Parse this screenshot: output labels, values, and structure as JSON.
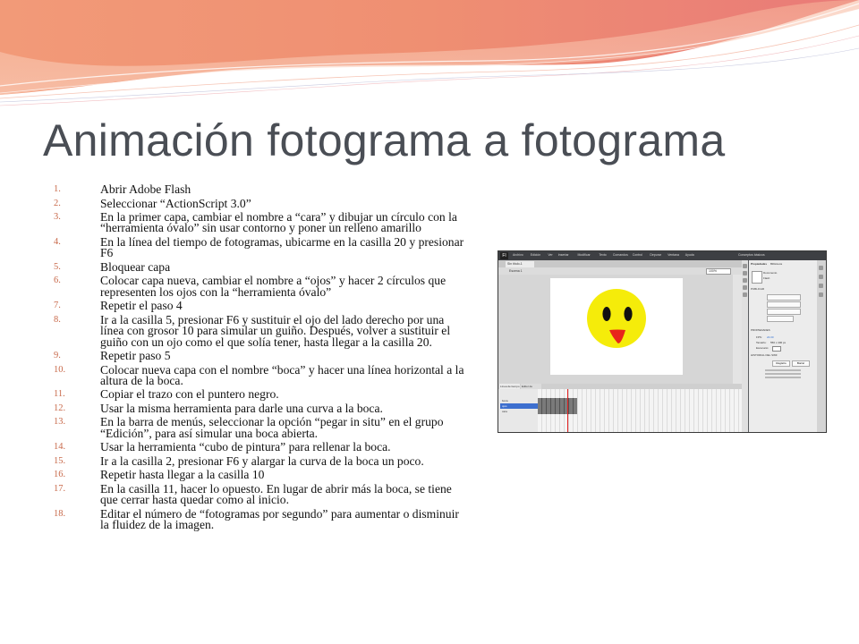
{
  "slide": {
    "title": "Animación fotograma a fotograma",
    "steps": [
      {
        "number": "1.",
        "text": "Abrir Adobe Flash"
      },
      {
        "number": "2.",
        "text": "Seleccionar “ActionScript 3.0”"
      },
      {
        "number": "3.",
        "text": "En la primer capa, cambiar el nombre a “cara” y dibujar un círculo con la “herramienta óvalo” sin usar contorno y poner un relleno amarillo"
      },
      {
        "number": "4.",
        "text": "En la línea del tiempo de fotogramas, ubicarme en la casilla 20 y presionar F6"
      },
      {
        "number": "5.",
        "text": "Bloquear capa"
      },
      {
        "number": "6.",
        "text": "Colocar capa nueva, cambiar el nombre a “ojos” y hacer 2 círculos que representen los ojos con la “herramienta óvalo”"
      },
      {
        "number": "7.",
        "text": "Repetir el paso 4"
      },
      {
        "number": "8.",
        "text": "Ir a la casilla 5, presionar F6 y sustituir el ojo del lado derecho por una línea con grosor 10 para simular un guiño. Después, volver a sustituir el guiño con un ojo como el que solía tener, hasta llegar a la casilla 20."
      },
      {
        "number": "9.",
        "text": "Repetir paso 5"
      },
      {
        "number": "10.",
        "text": "Colocar nueva capa con el nombre “boca” y hacer una línea horizontal a la altura de la boca."
      },
      {
        "number": "11.",
        "text": "Copiar el trazo con el puntero negro."
      },
      {
        "number": "12.",
        "text": "Usar la misma herramienta para darle una curva a la boca."
      },
      {
        "number": "13.",
        "text": "En la barra de menús, seleccionar la opción “pegar in situ” en el grupo “Edición”, para así simular una boca abierta."
      },
      {
        "number": "14.",
        "text": "Usar la herramienta “cubo de pintura” para rellenar la boca."
      },
      {
        "number": "15.",
        "text": "Ir a la casilla 2, presionar F6 y alargar la curva de la boca un poco."
      },
      {
        "number": "16.",
        "text": "Repetir hasta llegar a la casilla 10"
      },
      {
        "number": "17.",
        "text": "En la casilla 11, hacer lo opuesto. En lugar de abrir más la boca, se tiene que cerrar hasta quedar como al inicio."
      },
      {
        "number": "18.",
        "text": "Editar el número de “fotogramas por segundo” para aumentar o disminuir la fluidez de la imagen."
      }
    ]
  },
  "screenshot": {
    "app_logo": "Fl",
    "menu": [
      "Archivo",
      "Edición",
      "Ver",
      "Insertar",
      "Modificar",
      "Texto",
      "Comandos",
      "Control",
      "Depurar",
      "Ventana",
      "Ayuda"
    ],
    "workspace": "Conceptos básicos",
    "doc_tab": "Sin título-1",
    "scene": "Escena 1",
    "zoom": "100%",
    "timeline_tabs": [
      "Línea de tiempo",
      "Editor de movimiento"
    ],
    "layers": [
      "boca",
      "ojos",
      "cara"
    ],
    "selected_layer": "ojos",
    "props_tabs": [
      "Propiedades",
      "Biblioteca"
    ],
    "doc_label": "Documento",
    "doc_name": "Flash",
    "fps_label": "FPS:",
    "fps_value": "24.00",
    "size_label": "Tamaño:",
    "size_value": "550 x 400 px",
    "stage_label": "Escenario:",
    "publish_heading": "PUBLICAR",
    "props_heading": "PROPIEDADES",
    "history_heading": "HISTORIAL DEL SWF",
    "log_button": "Registro",
    "clear_button": "Borrar",
    "face_color": "#f5ec0a",
    "eye_color": "#111111",
    "mouth_color": "#e8251b"
  },
  "theme": {
    "title_color": "#4a4e55",
    "number_color": "#c8694a",
    "banner_color": "#f0826a"
  }
}
